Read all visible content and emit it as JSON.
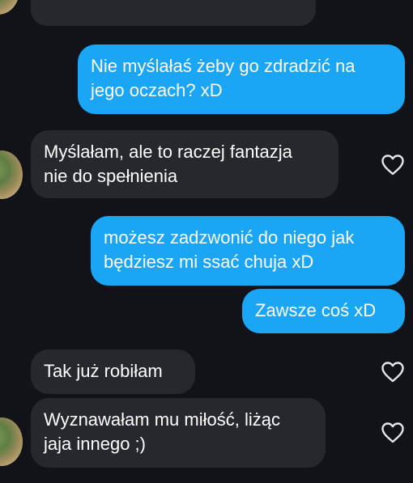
{
  "messages": [
    {
      "id": "m0",
      "side": "incoming",
      "text": ""
    },
    {
      "id": "m1",
      "side": "outgoing",
      "lines": [
        "Nie myślałaś żeby go zdradzić na",
        "jego oczach? xD"
      ]
    },
    {
      "id": "m2",
      "side": "incoming",
      "lines": [
        "Myślałam, ale to raczej fantazja",
        "nie do spełnienia"
      ]
    },
    {
      "id": "m3",
      "side": "outgoing",
      "lines": [
        "możesz zadzwonić do niego jak",
        "będziesz mi ssać chuja xD"
      ]
    },
    {
      "id": "m4",
      "side": "outgoing",
      "lines": [
        "Zawsze coś xD"
      ]
    },
    {
      "id": "m5",
      "side": "incoming",
      "lines": [
        "Tak już robiłam"
      ]
    },
    {
      "id": "m6",
      "side": "incoming",
      "lines": [
        "Wyznawałam mu miłość, liżąc",
        "jaja innego ;)"
      ]
    }
  ],
  "icons": {
    "like": "heart-outline-icon",
    "avatar": "contact-avatar"
  },
  "colors": {
    "background": "#121318",
    "incoming_bubble": "#26282e",
    "outgoing_bubble": "#1aa6f5",
    "text": "#ffffff",
    "heart_stroke": "#e6e6e6"
  }
}
